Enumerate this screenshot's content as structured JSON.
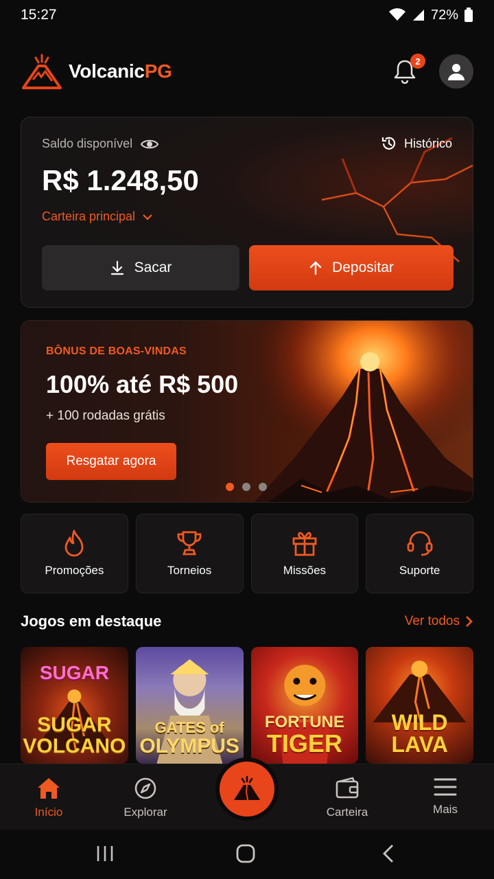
{
  "status_bar": {
    "time": "15:27",
    "battery": "72%"
  },
  "header": {
    "brand_main": "Volcanic",
    "brand_accent": "PG",
    "notifications_count": "2"
  },
  "balance": {
    "label": "Saldo disponível",
    "history_label": "Histórico",
    "amount": "R$ 1.248,50",
    "wallet_label": "Carteira principal",
    "withdraw_label": "Sacar",
    "deposit_label": "Depositar"
  },
  "promo": {
    "tag": "BÔNUS DE BOAS-VINDAS",
    "title": "100% até R$ 500",
    "subtitle": "+ 100 rodadas grátis",
    "cta": "Resgatar agora",
    "active_slide": 1,
    "slides": 3
  },
  "quick_actions": [
    {
      "label": "Promoções",
      "icon": "flame-icon"
    },
    {
      "label": "Torneios",
      "icon": "trophy-icon"
    },
    {
      "label": "Missões",
      "icon": "gift-icon"
    },
    {
      "label": "Suporte",
      "icon": "headset-icon"
    }
  ],
  "featured": {
    "title": "Jogos em destaque",
    "see_all": "Ver todos",
    "games": [
      {
        "top": "SUGAR",
        "line1": "SUGAR",
        "line2": "VOLCANO"
      },
      {
        "line1": "GATES of",
        "line2": "OLYMPUS"
      },
      {
        "line1": "FORTUNE",
        "line2": "TIGER"
      },
      {
        "line1": "WILD",
        "line2": "LAVA"
      }
    ]
  },
  "bottom_nav": {
    "home": "Início",
    "explore": "Explorar",
    "wallet": "Carteira",
    "more": "Mais"
  },
  "colors": {
    "accent": "#f05a22",
    "background": "#0c0b0b",
    "card": "#171515"
  }
}
